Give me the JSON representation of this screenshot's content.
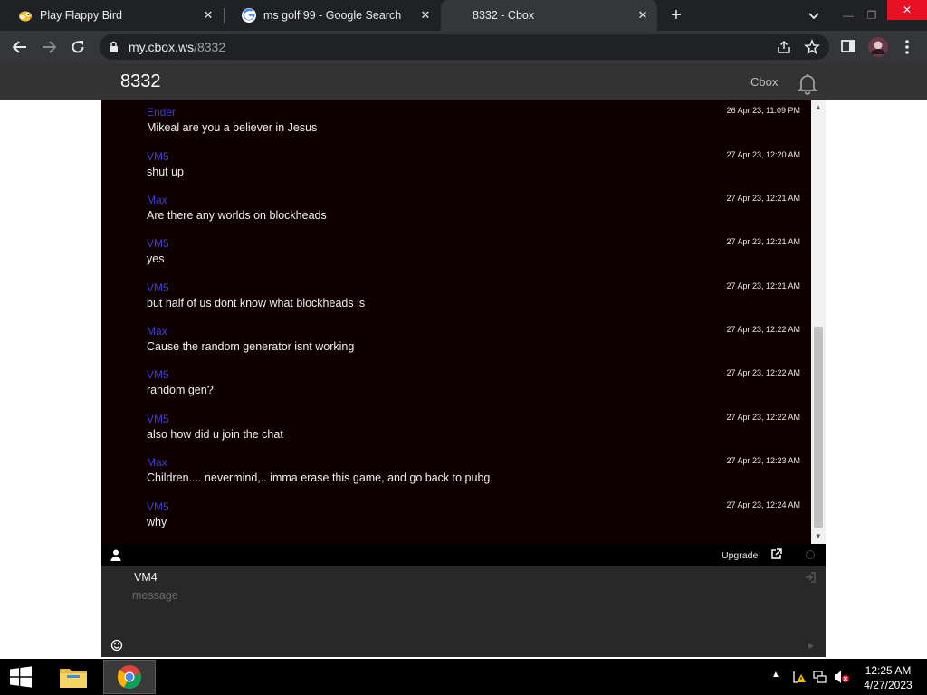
{
  "browser": {
    "tabs": [
      {
        "title": "Play Flappy Bird",
        "favicon": "flappy-bird-icon",
        "active": false
      },
      {
        "title": "ms golf 99 - Google Search",
        "favicon": "google-icon",
        "active": false
      },
      {
        "title": "8332 - Cbox",
        "favicon": "none",
        "active": true
      }
    ],
    "url_host": "my.cbox.ws",
    "url_path": "/8332"
  },
  "cbox": {
    "title": "8332",
    "brand": "Cbox",
    "messages": [
      {
        "name": "Ender",
        "text": "Mikeal are you a believer in Jesus",
        "time": "26 Apr 23, 11:09 PM"
      },
      {
        "name": "VM5",
        "text": "shut up",
        "time": "27 Apr 23, 12:20 AM"
      },
      {
        "name": "Max",
        "text": "Are there any worlds on blockheads",
        "time": "27 Apr 23, 12:21 AM"
      },
      {
        "name": "VM5",
        "text": "yes",
        "time": "27 Apr 23, 12:21 AM"
      },
      {
        "name": "VM5",
        "text": "but half of us dont know what blockheads is",
        "time": "27 Apr 23, 12:21 AM"
      },
      {
        "name": "Max",
        "text": "Cause the random generator isnt working",
        "time": "27 Apr 23, 12:22 AM"
      },
      {
        "name": "VM5",
        "text": "random gen?",
        "time": "27 Apr 23, 12:22 AM"
      },
      {
        "name": "VM5",
        "text": "also how did u join the chat",
        "time": "27 Apr 23, 12:22 AM"
      },
      {
        "name": "Max",
        "text": "Children.... nevermind,.. imma erase this game, and go back to pubg",
        "time": "27 Apr 23, 12:23 AM"
      },
      {
        "name": "VM5",
        "text": "why",
        "time": "27 Apr 23, 12:24 AM"
      }
    ],
    "upgrade_label": "Upgrade",
    "username": "VM4",
    "message_placeholder": "message"
  },
  "taskbar": {
    "time": "12:25 AM",
    "date": "4/27/2023"
  },
  "colors": {
    "chat_bg": "#0e0000",
    "username": "#3f3fd6",
    "header_bg": "#333333",
    "accent": "#e81123"
  }
}
